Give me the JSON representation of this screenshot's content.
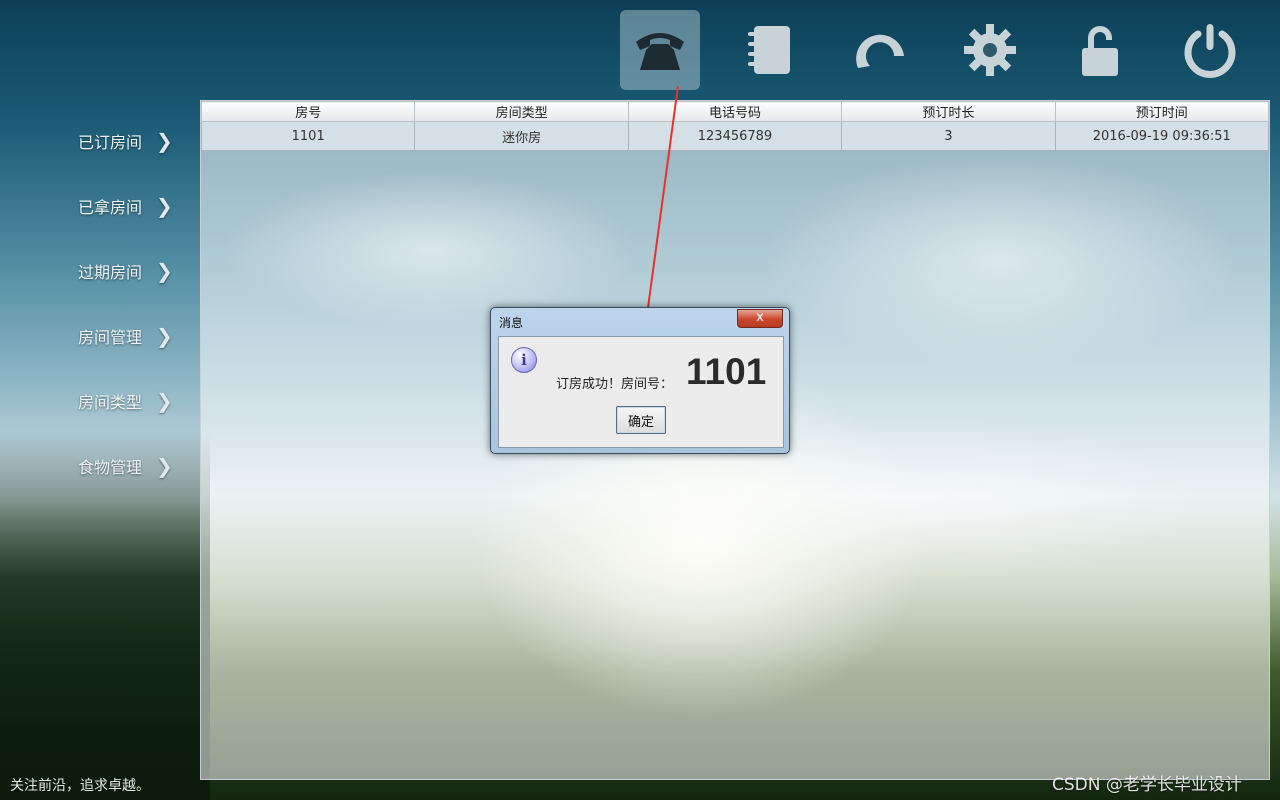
{
  "toolbar": {
    "items": [
      {
        "icon": "phone-icon",
        "active": true
      },
      {
        "icon": "notebook-icon",
        "active": false
      },
      {
        "icon": "refresh-icon",
        "active": false
      },
      {
        "icon": "gear-icon",
        "active": false
      },
      {
        "icon": "unlock-icon",
        "active": false
      },
      {
        "icon": "power-icon",
        "active": false
      }
    ]
  },
  "sidebar": {
    "items": [
      {
        "label": "已订房间"
      },
      {
        "label": "已拿房间"
      },
      {
        "label": "过期房间"
      },
      {
        "label": "房间管理"
      },
      {
        "label": "房间类型"
      },
      {
        "label": "食物管理"
      }
    ],
    "chevron": "❯"
  },
  "table": {
    "headers": [
      "房号",
      "房间类型",
      "电话号码",
      "预订时长",
      "预订时间"
    ],
    "rows": [
      [
        "1101",
        "迷你房",
        "123456789",
        "3",
        "2016-09-19 09:36:51"
      ]
    ]
  },
  "dialog": {
    "title": "消息",
    "close_label": "x",
    "icon": "info-icon",
    "icon_glyph": "i",
    "message": "订房成功！房间号：",
    "room_number": "1101",
    "ok_label": "确定"
  },
  "footer": {
    "slogan": "关注前沿，追求卓越。",
    "watermark": "CSDN @老学长毕业设计"
  },
  "colors": {
    "arrow": "#e8312a",
    "close_button": "#c9482e"
  }
}
